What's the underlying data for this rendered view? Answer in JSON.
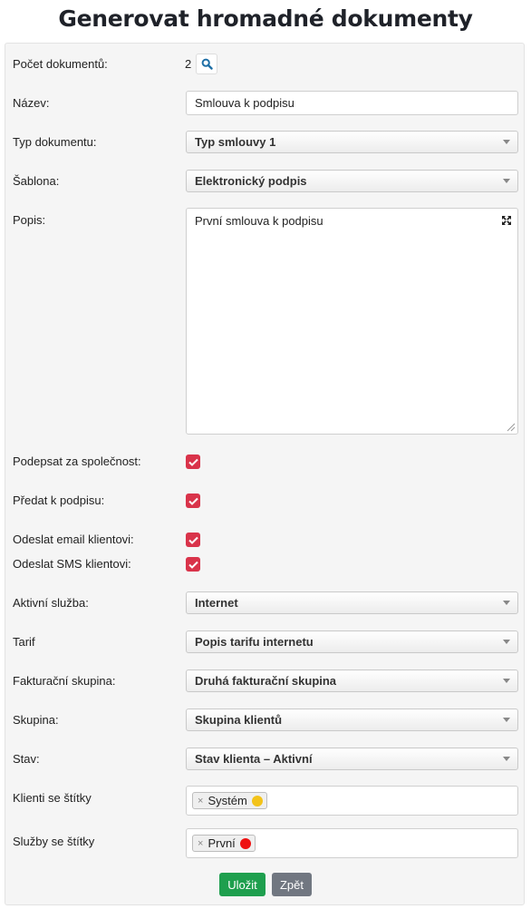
{
  "title": "Generovat hromadné dokumenty",
  "form": {
    "count_label": "Počet dokumentů:",
    "count_value": "2",
    "name_label": "Název:",
    "name_value": "Smlouva k podpisu",
    "doctype_label": "Typ dokumentu:",
    "doctype_value": "Typ smlouvy 1",
    "template_label": "Šablona:",
    "template_value": "Elektronický podpis",
    "desc_label": "Popis:",
    "desc_value": "První smlouva k podpisu",
    "sign_company_label": "Podepsat za společnost:",
    "sign_company_checked": true,
    "hand_over_label": "Předat k podpisu:",
    "hand_over_checked": true,
    "send_email_label": "Odeslat email klientovi:",
    "send_email_checked": true,
    "send_sms_label": "Odeslat SMS klientovi:",
    "send_sms_checked": true,
    "service_label": "Aktivní služba:",
    "service_value": "Internet",
    "tariff_label": "Tarif",
    "tariff_value": "Popis tarifu internetu",
    "billing_label": "Fakturační skupina:",
    "billing_value": "Druhá fakturační skupina",
    "group_label": "Skupina:",
    "group_value": "Skupina klientů",
    "state_label": "Stav:",
    "state_value": "Stav klienta – Aktivní",
    "client_tags_label": "Klienti se štítky",
    "client_tag": {
      "label": "Systém",
      "color": "#f3c31a"
    },
    "service_tags_label": "Služby se štítky",
    "service_tag": {
      "label": "První",
      "color": "#ee1111"
    }
  },
  "buttons": {
    "save": "Uložit",
    "back": "Zpět"
  },
  "colors": {
    "checkbox": "#d9334a",
    "save": "#1e9f4e",
    "back": "#717781",
    "search_icon": "#1f6fa6"
  }
}
